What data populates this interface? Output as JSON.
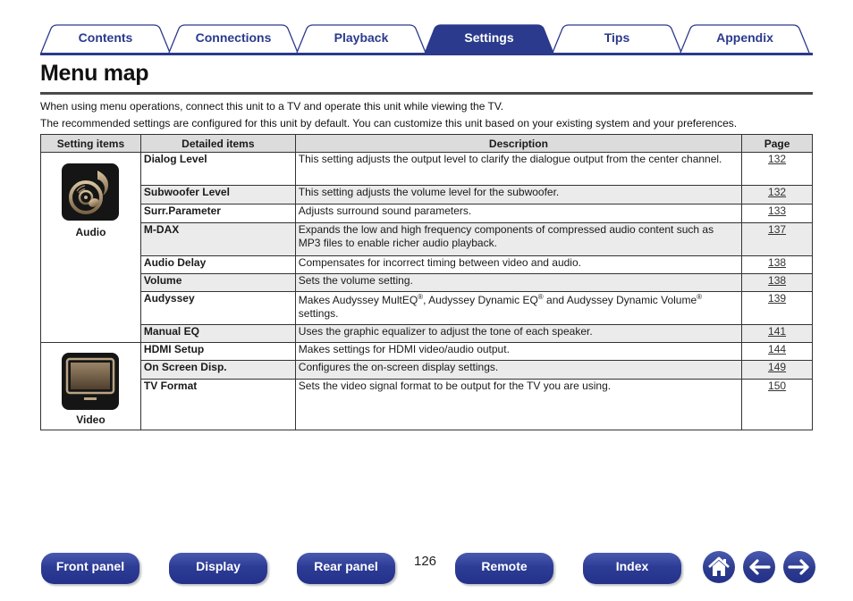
{
  "tabs": [
    {
      "label": "Contents",
      "active": false
    },
    {
      "label": "Connections",
      "active": false
    },
    {
      "label": "Playback",
      "active": false
    },
    {
      "label": "Settings",
      "active": true
    },
    {
      "label": "Tips",
      "active": false
    },
    {
      "label": "Appendix",
      "active": false
    }
  ],
  "page_title": "Menu map",
  "intro": [
    "When using menu operations, connect this unit to a TV and operate this unit while viewing the TV.",
    "The recommended settings are configured for this unit by default. You can customize this unit based on your existing system and your preferences."
  ],
  "table": {
    "headers": [
      "Setting items",
      "Detailed items",
      "Description",
      "Page"
    ],
    "categories": [
      {
        "name": "Audio",
        "icon": "music-disc-icon",
        "rows": [
          {
            "item": "Dialog Level",
            "desc": "This setting adjusts the output level to clarify the dialogue output from the center channel.",
            "page": "132"
          },
          {
            "item": "Subwoofer Level",
            "desc": "This setting adjusts the volume level for the subwoofer.",
            "page": "132"
          },
          {
            "item": "Surr.Parameter",
            "desc": "Adjusts surround sound parameters.",
            "page": "133"
          },
          {
            "item": "M-DAX",
            "desc": "Expands the low and high frequency components of compressed audio content such as MP3 files to enable richer audio playback.",
            "page": "137"
          },
          {
            "item": "Audio Delay",
            "desc": "Compensates for incorrect timing between video and audio.",
            "page": "138"
          },
          {
            "item": "Volume",
            "desc": "Sets the volume setting.",
            "page": "138"
          },
          {
            "item": "Audyssey",
            "desc_parts": [
              "Makes Audyssey MultEQ",
              "®",
              ", Audyssey Dynamic EQ",
              "®",
              " and Audyssey Dynamic Volume",
              "®",
              " settings."
            ],
            "page": "139"
          },
          {
            "item": "Manual EQ",
            "desc": "Uses the graphic equalizer to adjust the tone of each speaker.",
            "page": "141"
          }
        ]
      },
      {
        "name": "Video",
        "icon": "tv-monitor-icon",
        "rows": [
          {
            "item": "HDMI Setup",
            "desc": "Makes settings for HDMI video/audio output.",
            "page": "144"
          },
          {
            "item": "On Screen Disp.",
            "desc": "Configures the on-screen display settings.",
            "page": "149"
          },
          {
            "item": "TV Format",
            "desc": "Sets the video signal format to be output for the TV you are using.",
            "page": "150"
          }
        ]
      }
    ]
  },
  "footer": {
    "buttons": [
      "Front panel",
      "Display",
      "Rear panel",
      "Remote",
      "Index"
    ],
    "page_number": "126",
    "icons": [
      "home-icon",
      "back-arrow-icon",
      "forward-arrow-icon"
    ]
  }
}
